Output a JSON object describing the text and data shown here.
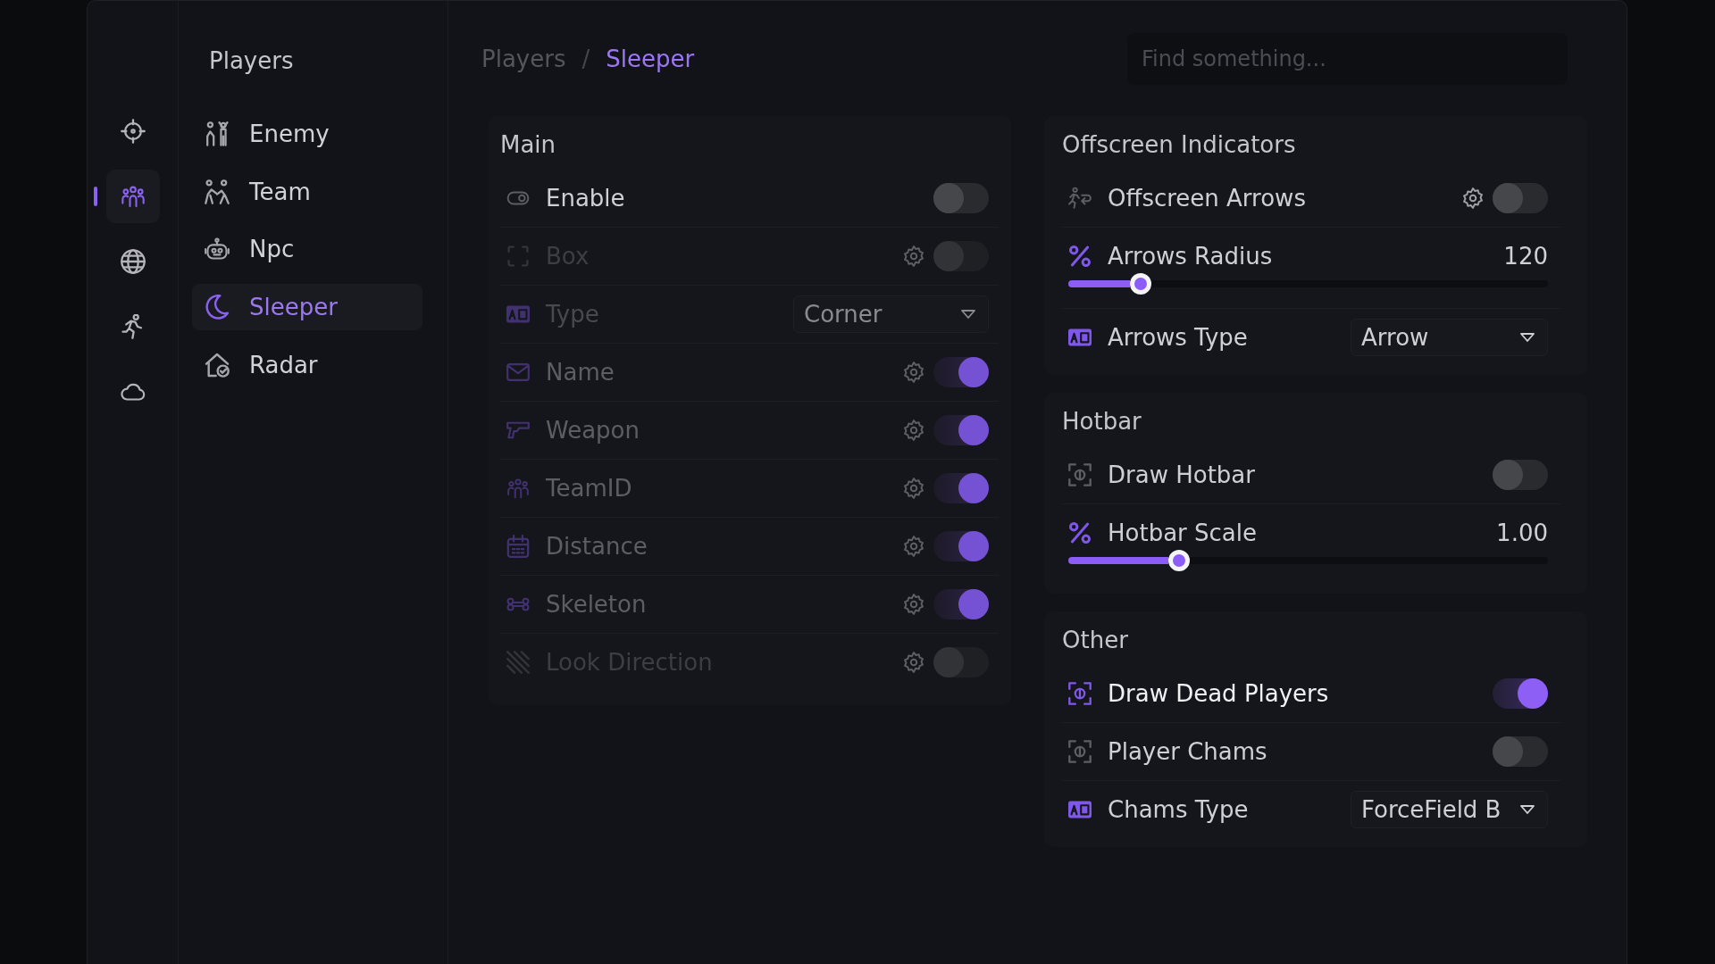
{
  "nav_rail": [
    {
      "selected": false
    },
    {
      "selected": true
    },
    {
      "selected": false
    },
    {
      "selected": false
    },
    {
      "selected": false
    }
  ],
  "sidebar": {
    "title": "Players",
    "items": [
      {
        "label": "Enemy",
        "selected": false
      },
      {
        "label": "Team",
        "selected": false
      },
      {
        "label": "Npc",
        "selected": false
      },
      {
        "label": "Sleeper",
        "selected": true
      },
      {
        "label": "Radar",
        "selected": false
      }
    ]
  },
  "breadcrumb": {
    "path": [
      "Players",
      "Sleeper"
    ],
    "separator": "/"
  },
  "search": {
    "placeholder": "Find something..."
  },
  "columns": [
    [
      {
        "title": "Main",
        "rows": [
          {
            "kind": "toggle",
            "label": "Enable",
            "settings": false,
            "on": false,
            "disabled": false
          },
          {
            "kind": "toggle",
            "label": "Box",
            "settings": true,
            "on": false,
            "disabled": true
          },
          {
            "kind": "dropdown",
            "label": "Type",
            "value": "Corner",
            "disabled": true
          },
          {
            "kind": "toggle",
            "label": "Name",
            "settings": true,
            "on": true,
            "disabled": true
          },
          {
            "kind": "toggle",
            "label": "Weapon",
            "settings": true,
            "on": true,
            "disabled": true
          },
          {
            "kind": "toggle",
            "label": "TeamID",
            "settings": true,
            "on": true,
            "disabled": true
          },
          {
            "kind": "toggle",
            "label": "Distance",
            "settings": true,
            "on": true,
            "disabled": true
          },
          {
            "kind": "toggle",
            "label": "Skeleton",
            "settings": true,
            "on": true,
            "disabled": true
          },
          {
            "kind": "toggle",
            "label": "Look Direction",
            "settings": true,
            "on": false,
            "disabled": true
          }
        ]
      }
    ],
    [
      {
        "title": "Offscreen Indicators",
        "rows": [
          {
            "kind": "toggle",
            "label": "Offscreen Arrows",
            "settings": true,
            "on": false,
            "disabled": false
          },
          {
            "kind": "slider",
            "label": "Arrows Radius",
            "reading": "120",
            "level": 0.15,
            "disabled": false
          },
          {
            "kind": "dropdown",
            "label": "Arrows Type",
            "value": "Arrow",
            "disabled": false
          }
        ]
      },
      {
        "title": "Hotbar",
        "rows": [
          {
            "kind": "toggle",
            "label": "Draw Hotbar",
            "settings": false,
            "on": false,
            "disabled": false
          },
          {
            "kind": "slider",
            "label": "Hotbar Scale",
            "reading": "1.00",
            "level": 0.23,
            "disabled": false
          }
        ]
      },
      {
        "title": "Other",
        "rows": [
          {
            "kind": "toggle",
            "label": "Draw Dead Players",
            "settings": false,
            "on": true,
            "disabled": false
          },
          {
            "kind": "toggle",
            "label": "Player Chams",
            "settings": false,
            "on": false,
            "disabled": false
          },
          {
            "kind": "dropdown",
            "label": "Chams Type",
            "value": "ForceField B",
            "disabled": false
          }
        ]
      }
    ]
  ]
}
